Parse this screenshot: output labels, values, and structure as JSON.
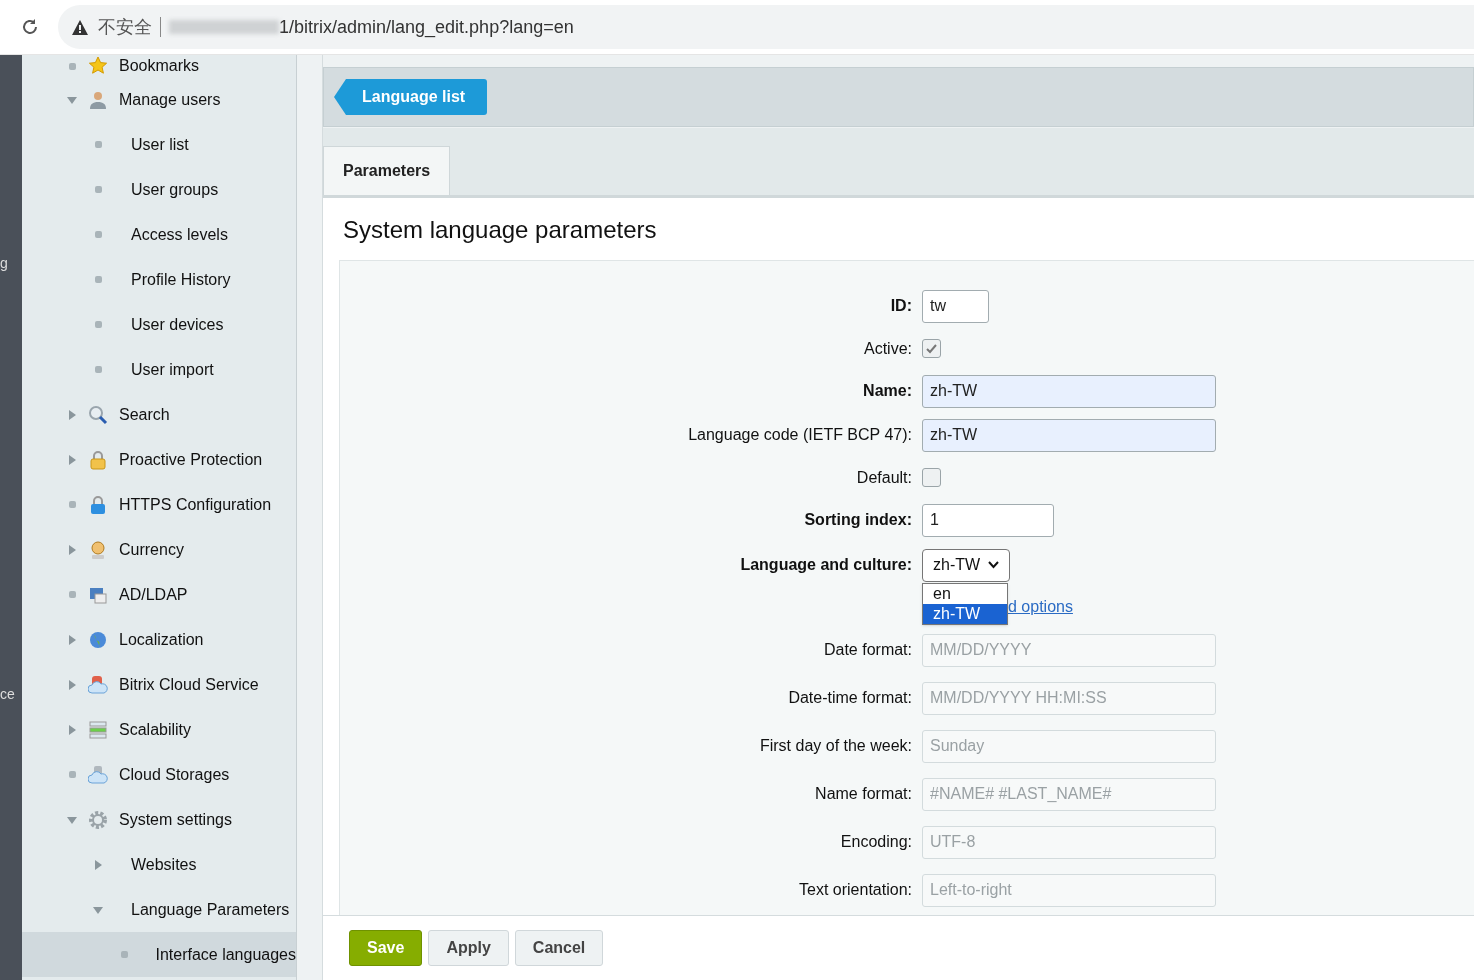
{
  "browser": {
    "security_label": "不安全",
    "url": "1/bitrix/admin/lang_edit.php?lang=en"
  },
  "left_strip": [
    "g",
    "ce"
  ],
  "sidebar": {
    "items": [
      {
        "label": "Bookmarks",
        "kind": "leaf",
        "selected": false
      },
      {
        "label": "Manage users",
        "kind": "folder",
        "expanded": true,
        "selected": false,
        "children": [
          {
            "label": "User list",
            "kind": "leaf",
            "selected": false
          },
          {
            "label": "User groups",
            "kind": "leaf",
            "selected": false
          },
          {
            "label": "Access levels",
            "kind": "leaf",
            "selected": false
          },
          {
            "label": "Profile History",
            "kind": "leaf",
            "selected": false
          },
          {
            "label": "User devices",
            "kind": "leaf",
            "selected": false
          },
          {
            "label": "User import",
            "kind": "leaf",
            "selected": false
          }
        ]
      },
      {
        "label": "Search",
        "kind": "folder",
        "expanded": false,
        "selected": false
      },
      {
        "label": "Proactive Protection",
        "kind": "folder",
        "expanded": false,
        "selected": false
      },
      {
        "label": "HTTPS Configuration",
        "kind": "leaf",
        "selected": false
      },
      {
        "label": "Currency",
        "kind": "folder",
        "expanded": false,
        "selected": false
      },
      {
        "label": "AD/LDAP",
        "kind": "leaf",
        "selected": false
      },
      {
        "label": "Localization",
        "kind": "folder",
        "expanded": false,
        "selected": false
      },
      {
        "label": "Bitrix Cloud Service",
        "kind": "folder",
        "expanded": false,
        "selected": false
      },
      {
        "label": "Scalability",
        "kind": "folder",
        "expanded": false,
        "selected": false
      },
      {
        "label": "Cloud Storages",
        "kind": "leaf",
        "selected": false
      },
      {
        "label": "System settings",
        "kind": "folder",
        "expanded": true,
        "selected": false,
        "children": [
          {
            "label": "Websites",
            "kind": "folder",
            "expanded": false,
            "selected": false
          },
          {
            "label": "Language Parameters",
            "kind": "folder",
            "expanded": true,
            "selected": false,
            "children": [
              {
                "label": "Interface languages",
                "kind": "leaf",
                "selected": true
              }
            ]
          }
        ]
      }
    ]
  },
  "toolbar": {
    "button": "Language list"
  },
  "tabs": [
    {
      "label": "Parameters",
      "selected": true
    }
  ],
  "form": {
    "title": "System language parameters",
    "fields": [
      {
        "kind": "text",
        "label": "ID:",
        "bold": true,
        "value": "tw",
        "highlighted": false
      },
      {
        "kind": "checkbox",
        "label": "Active:",
        "bold": false,
        "checked": true
      },
      {
        "kind": "text",
        "label": "Name:",
        "bold": true,
        "value": "zh-TW",
        "highlighted": true
      },
      {
        "kind": "text",
        "label": "Language code (IETF BCP 47):",
        "bold": false,
        "value": "zh-TW",
        "highlighted": true
      },
      {
        "kind": "checkbox",
        "label": "Default:",
        "bold": false,
        "checked": false
      },
      {
        "kind": "text",
        "label": "Sorting index:",
        "bold": true,
        "value": "1",
        "highlighted": false
      },
      {
        "kind": "select",
        "label": "Language and culture:",
        "bold": true,
        "value": "zh-TW",
        "expanded": true,
        "options": [
          {
            "label": "en",
            "selected": false
          },
          {
            "label": "zh-TW",
            "selected": true
          }
        ]
      },
      {
        "kind": "link",
        "label": "d options"
      },
      {
        "kind": "text",
        "label": "Date format:",
        "bold": false,
        "placeholder": "MM/DD/YYYY",
        "disabled": true
      },
      {
        "kind": "text",
        "label": "Date-time format:",
        "bold": false,
        "placeholder": "MM/DD/YYYY HH:MI:SS",
        "disabled": true
      },
      {
        "kind": "text",
        "label": "First day of the week:",
        "bold": false,
        "placeholder": "Sunday",
        "disabled": true
      },
      {
        "kind": "text",
        "label": "Name format:",
        "bold": false,
        "placeholder": "#NAME# #LAST_NAME#",
        "disabled": true
      },
      {
        "kind": "text",
        "label": "Encoding:",
        "bold": false,
        "placeholder": "UTF-8",
        "disabled": true
      },
      {
        "kind": "text",
        "label": "Text orientation:",
        "bold": false,
        "placeholder": "Left-to-right",
        "disabled": true
      }
    ]
  },
  "buttons": [
    {
      "label": "Save",
      "kind": "primary"
    },
    {
      "label": "Apply",
      "kind": "default"
    },
    {
      "label": "Cancel",
      "kind": "default"
    }
  ]
}
